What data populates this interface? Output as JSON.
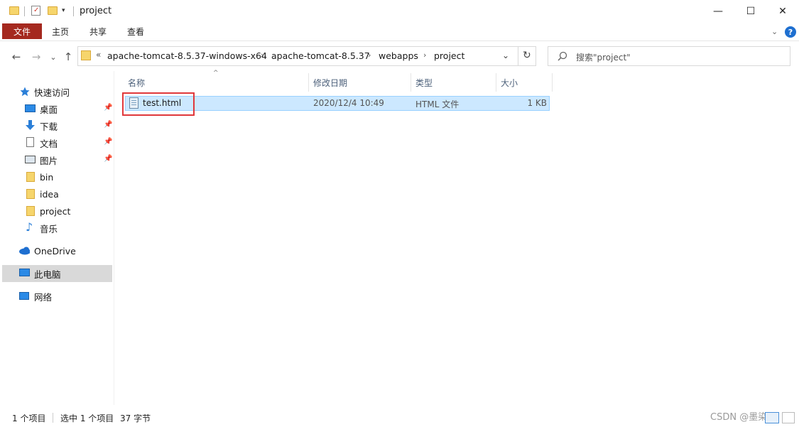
{
  "window": {
    "title": "project",
    "minimize": "—",
    "maximize": "☐",
    "close": "✕"
  },
  "ribbon": {
    "tabs": [
      "文件",
      "主页",
      "共享",
      "查看"
    ],
    "help": "?"
  },
  "navigation": {
    "back": "←",
    "forward": "→",
    "recent": "⌄",
    "up": "↑",
    "overflow": "«",
    "breadcrumbs": [
      "apache-tomcat-8.5.37-windows-x64",
      "apache-tomcat-8.5.37",
      "webapps",
      "project"
    ],
    "refresh": "↻"
  },
  "search": {
    "placeholder": "搜索\"project\""
  },
  "sidebar": {
    "items": [
      {
        "label": "快速访问",
        "icon": "star-icon"
      },
      {
        "label": "桌面",
        "icon": "desktop-icon",
        "pinned": true
      },
      {
        "label": "下载",
        "icon": "download-icon",
        "pinned": true
      },
      {
        "label": "文档",
        "icon": "document-icon",
        "pinned": true
      },
      {
        "label": "图片",
        "icon": "picture-icon",
        "pinned": true
      },
      {
        "label": "bin",
        "icon": "folder-icon"
      },
      {
        "label": "idea",
        "icon": "folder-icon"
      },
      {
        "label": "project",
        "icon": "folder-icon"
      },
      {
        "label": "音乐",
        "icon": "music-icon"
      },
      {
        "label": "OneDrive",
        "icon": "cloud-icon"
      },
      {
        "label": "此电脑",
        "icon": "computer-icon",
        "selected": true
      },
      {
        "label": "网络",
        "icon": "network-icon"
      }
    ]
  },
  "columns": [
    "名称",
    "修改日期",
    "类型",
    "大小"
  ],
  "files": [
    {
      "name": "test.html",
      "modified": "2020/12/4 10:49",
      "type": "HTML 文件",
      "size": "1 KB"
    }
  ],
  "status": {
    "count": "1 个项目",
    "selected": "选中 1 个项目",
    "size": "37 字节"
  },
  "watermark": "CSDN @墨染ꞋꞋ"
}
